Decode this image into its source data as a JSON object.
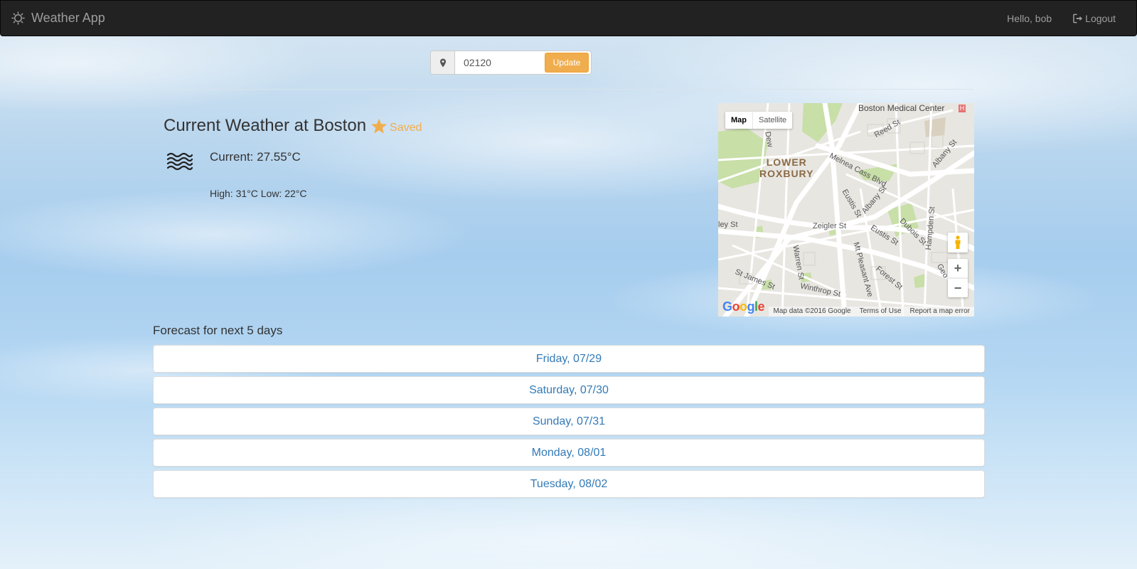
{
  "navbar": {
    "brand_icon": "sun-icon",
    "brand": "Weather App",
    "greeting": "Hello, bob",
    "logout_icon": "logout-icon",
    "logout": "Logout"
  },
  "search": {
    "icon": "map-marker-icon",
    "zip": "02120",
    "update_label": "Update"
  },
  "current": {
    "title": "Current Weather at Boston",
    "saved_icon": "star-icon",
    "saved_label": "Saved",
    "condition_icon": "haze-wave-icon",
    "current_text": "Current: 27.55°C",
    "hilo_text": "High: 31°C Low: 22°C"
  },
  "map": {
    "type_map": "Map",
    "type_satellite": "Satellite",
    "labels": {
      "hospital": "Boston Medical Center",
      "neighborhood_1": "LOWER",
      "neighborhood_2": "ROXBURY",
      "s1": "Melnea Cass Blvd",
      "s2": "Reed St",
      "s3": "Albany St",
      "s4": "Albany St",
      "s5": "Eustis St",
      "s6": "Zeigler St",
      "s7": "Eustis St",
      "s8": "Dubois St",
      "s9": "Hampden St",
      "s10": "Warren St",
      "s11": "Mt Pleasant Ave",
      "s12": "Forest St",
      "s13": "St James St",
      "s14": "Winthrop St",
      "s15": "ley St",
      "s16": "Dew",
      "s17": "Geo"
    },
    "zoom_in": "+",
    "zoom_out": "−",
    "logo": "Google",
    "attribution": "Map data ©2016 Google",
    "terms": "Terms of Use",
    "report": "Report a map error"
  },
  "forecast": {
    "title": "Forecast for next 5 days",
    "days": [
      "Friday, 07/29",
      "Saturday, 07/30",
      "Sunday, 07/31",
      "Monday, 08/01",
      "Tuesday, 08/02"
    ]
  },
  "colors": {
    "navbar": "#222222",
    "accent": "#f0ad4e",
    "link": "#337ab7"
  }
}
